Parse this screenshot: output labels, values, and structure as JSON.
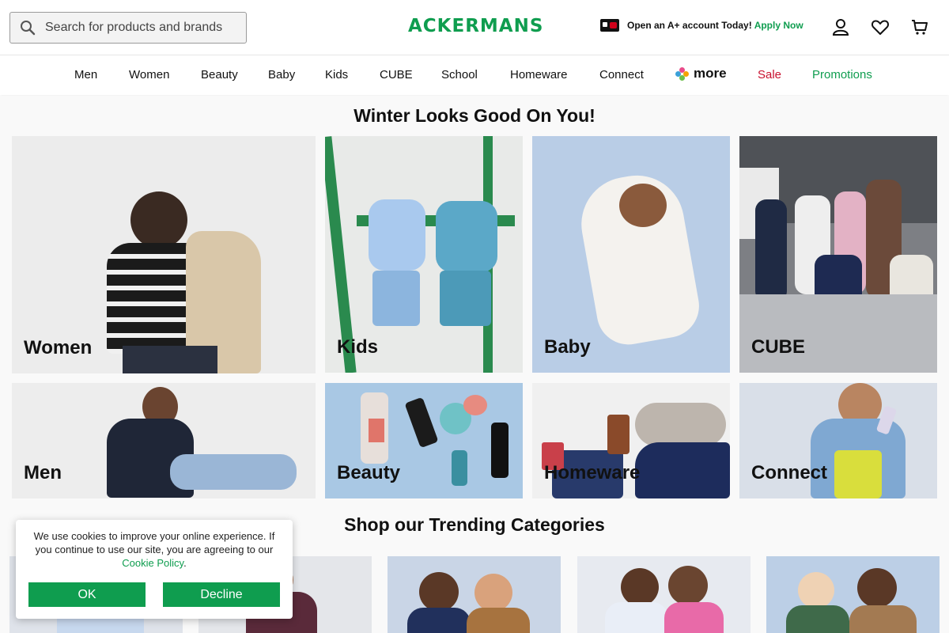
{
  "search": {
    "placeholder": "Search for products and brands"
  },
  "brand": {
    "logo_text": "ACKERMANS",
    "color": "#0f9d4f"
  },
  "promo": {
    "text": "Open an A+ account Today!",
    "link": "Apply Now"
  },
  "nav": {
    "items": [
      "Men",
      "Women",
      "Beauty",
      "Baby",
      "Kids",
      "CUBE",
      "School",
      "Homeware",
      "Connect"
    ],
    "more_label": "more",
    "sale_label": "Sale",
    "promotions_label": "Promotions",
    "sale_color": "#c8102e"
  },
  "hero": {
    "title": "Winter Looks Good On You!"
  },
  "tiles": [
    {
      "label": "Women"
    },
    {
      "label": "Kids"
    },
    {
      "label": "Baby"
    },
    {
      "label": "CUBE"
    },
    {
      "label": "Men"
    },
    {
      "label": "Beauty"
    },
    {
      "label": "Homeware"
    },
    {
      "label": "Connect"
    }
  ],
  "trending": {
    "title": "Shop our Trending Categories"
  },
  "cookie": {
    "text": "We use cookies to improve your online experience. If you continue to use our site, you are agreeing to our",
    "link": "Cookie Policy",
    "ok": "OK",
    "decline": "Decline"
  },
  "icons": [
    "search-icon",
    "account-icon",
    "wishlist-heart-icon",
    "cart-icon",
    "more-logo-icon",
    "credit-card-icon"
  ]
}
